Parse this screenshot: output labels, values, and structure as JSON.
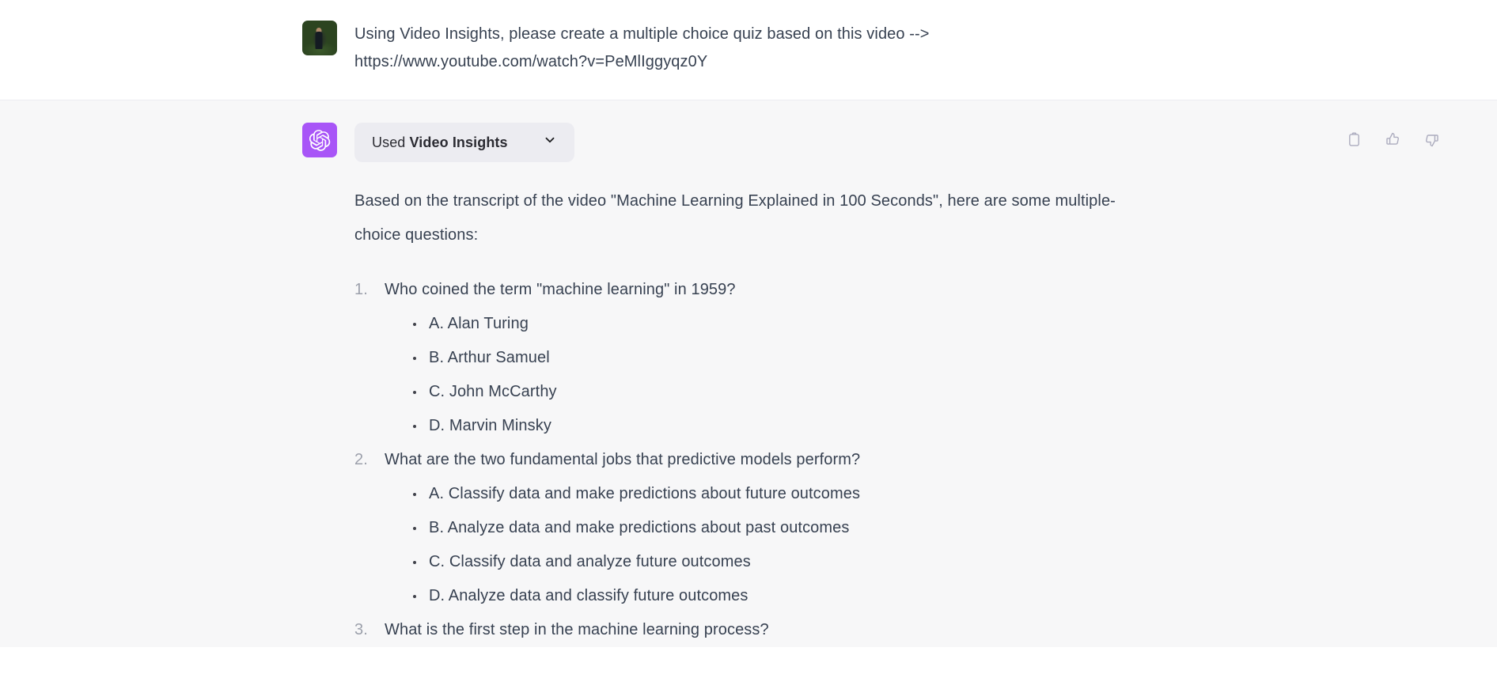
{
  "colors": {
    "user_bg": "#ffffff",
    "assistant_bg": "#f7f7f8",
    "divider": "#ececf1",
    "text": "#374151",
    "muted_text": "#9ca0ab",
    "pill_bg": "#ececf1",
    "gpt_avatar": "#a855f7",
    "icon": "#acacbe"
  },
  "user_message": {
    "avatar_name": "user-avatar-photo",
    "text": "Using Video Insights, please create a multiple choice quiz based on this video -->\nhttps://www.youtube.com/watch?v=PeMlIggyqz0Y"
  },
  "assistant_message": {
    "avatar_name": "chatgpt-avatar",
    "tool_pill": {
      "prefix": "Used ",
      "tool_name": "Video Insights",
      "chevron_icon": "chevron-down-icon"
    },
    "intro": "Based on the transcript of the video \"Machine Learning Explained in 100 Seconds\", here are some multiple-choice questions:",
    "questions": [
      {
        "number": "1.",
        "text": "Who coined the term \"machine learning\" in 1959?",
        "options": [
          "A. Alan Turing",
          "B. Arthur Samuel",
          "C. John McCarthy",
          "D. Marvin Minsky"
        ]
      },
      {
        "number": "2.",
        "text": "What are the two fundamental jobs that predictive models perform?",
        "options": [
          "A. Classify data and make predictions about future outcomes",
          "B. Analyze data and make predictions about past outcomes",
          "C. Classify data and analyze future outcomes",
          "D. Analyze data and classify future outcomes"
        ]
      },
      {
        "number": "3.",
        "text": "What is the first step in the machine learning process?",
        "options": []
      }
    ],
    "actions": [
      {
        "name": "copy-button",
        "icon": "clipboard-icon",
        "label": "Copy"
      },
      {
        "name": "thumbs-up-button",
        "icon": "thumbs-up-icon",
        "label": "Good response"
      },
      {
        "name": "thumbs-down-button",
        "icon": "thumbs-down-icon",
        "label": "Bad response"
      }
    ]
  }
}
